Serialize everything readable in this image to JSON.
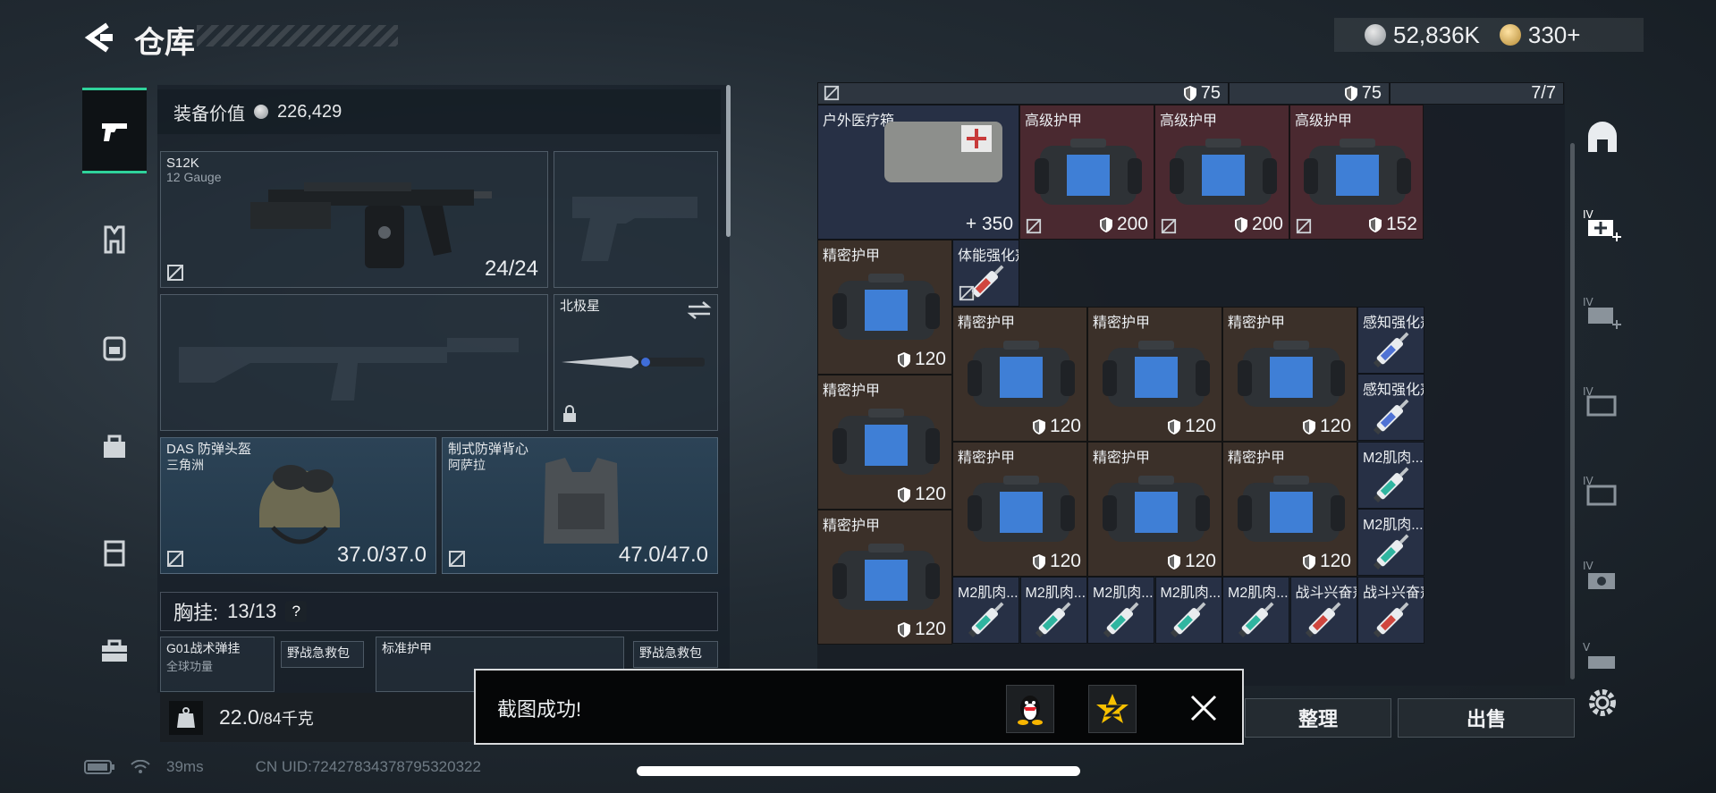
{
  "header": {
    "title": "仓库",
    "silver": "52,836K",
    "gold": "330+"
  },
  "loadout": {
    "value_label": "装备价值",
    "value": "226,429",
    "primary": {
      "name": "S12K",
      "caliber": "12 Gauge",
      "ammo": "24/24"
    },
    "melee": {
      "name": "北极星"
    },
    "helmet": {
      "name": "DAS 防弹头盔",
      "maker": "三角洲",
      "durability": "37.0/37.0"
    },
    "vest": {
      "name": "制式防弹背心",
      "maker": "阿萨拉",
      "durability": "47.0/47.0"
    },
    "chest_rig": {
      "label": "胸挂:",
      "count": "13/13",
      "help": "?"
    },
    "rig_items": [
      "G01战术弹挂",
      "野战急救包",
      "标准护甲",
      "野战急救包"
    ],
    "rig_sub": "全球功量",
    "weight": {
      "value": "22.0",
      "max": "/84千克",
      "unit_icon": "KG"
    }
  },
  "inventory": {
    "top_strip": [
      "75",
      "75",
      "7/7"
    ],
    "cells": [
      {
        "name": "户外医疗箱",
        "value": "+ 350",
        "color": "navy"
      },
      {
        "name": "高级护甲",
        "value": "200",
        "color": "red"
      },
      {
        "name": "高级护甲",
        "value": "200",
        "color": "red"
      },
      {
        "name": "高级护甲",
        "value": "152",
        "color": "red"
      },
      {
        "name": "精密护甲",
        "value": "120",
        "color": "brown"
      },
      {
        "name": "体能强化剂",
        "value": "",
        "color": "navy"
      },
      {
        "name": "精密护甲",
        "value": "120",
        "color": "brown"
      },
      {
        "name": "精密护甲",
        "value": "120",
        "color": "brown"
      },
      {
        "name": "精密护甲",
        "value": "120",
        "color": "brown"
      },
      {
        "name": "感知强化剂",
        "value": "",
        "color": "navy"
      },
      {
        "name": "精密护甲",
        "value": "120",
        "color": "brown"
      },
      {
        "name": "感知强化剂",
        "value": "",
        "color": "navy"
      },
      {
        "name": "精密护甲",
        "value": "120",
        "color": "brown"
      },
      {
        "name": "精密护甲",
        "value": "120",
        "color": "brown"
      },
      {
        "name": "精密护甲",
        "value": "120",
        "color": "brown"
      },
      {
        "name": "M2肌肉...",
        "value": "",
        "color": "navy"
      },
      {
        "name": "精密护甲",
        "value": "120",
        "color": "brown"
      },
      {
        "name": "M2肌肉...",
        "value": "",
        "color": "navy"
      },
      {
        "name": "M2肌肉...",
        "value": "",
        "color": "navy"
      },
      {
        "name": "M2肌肉...",
        "value": "",
        "color": "navy"
      },
      {
        "name": "M2肌肉...",
        "value": "",
        "color": "navy"
      },
      {
        "name": "M2肌肉...",
        "value": "",
        "color": "navy"
      },
      {
        "name": "M2肌肉...",
        "value": "",
        "color": "navy"
      },
      {
        "name": "战斗兴奋剂",
        "value": "",
        "color": "navy"
      },
      {
        "name": "战斗兴奋剂",
        "value": "",
        "color": "navy"
      }
    ]
  },
  "actions": {
    "sort": "整理",
    "sell": "出售"
  },
  "toast": {
    "message": "截图成功!"
  },
  "status_bar": {
    "ping": "39ms",
    "uid": "CN UID:72427834378795320322"
  },
  "colors": {
    "accent": "#2fd29b",
    "red_cell": "#4a2930",
    "brown_cell": "#3b3029",
    "navy_cell": "#273045"
  }
}
